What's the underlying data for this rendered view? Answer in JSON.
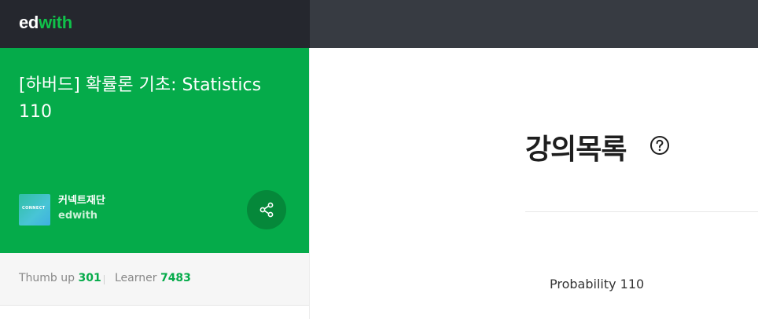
{
  "header": {
    "logo_ed": "ed",
    "logo_with": "with"
  },
  "course": {
    "title": "[하버드] 확률론 기초: Statistics 110",
    "partner_logo_text": "CONNECT",
    "partner_name": "커넥트재단",
    "partner_sub": "edwith",
    "share_icon": "share-icon"
  },
  "stats": {
    "thumb_label": "Thumb up",
    "thumb_value": "301",
    "learner_label": "Learner",
    "learner_value": "7483"
  },
  "main": {
    "section_title": "강의목록",
    "help_icon": "help-circle-icon",
    "lectures": [
      {
        "title": "Probability 110"
      }
    ]
  },
  "colors": {
    "brand_green": "#05ab4a",
    "topbar_dark": "#25272e",
    "topbar_gray": "#373b42"
  }
}
